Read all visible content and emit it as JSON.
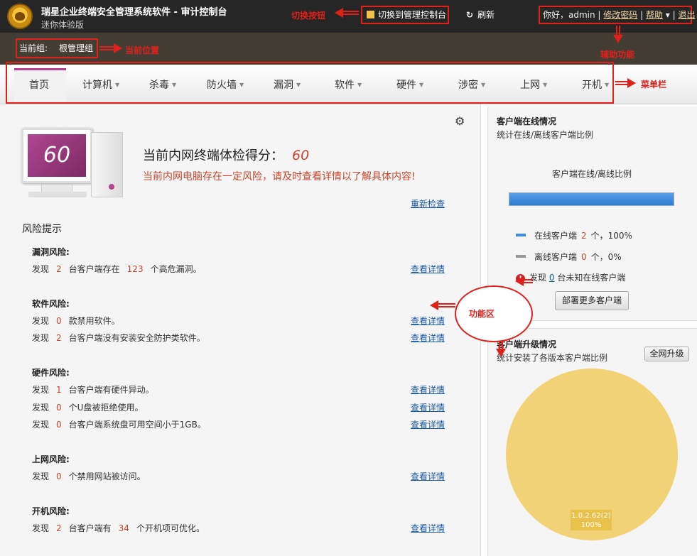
{
  "header": {
    "app_title": "瑞星企业终端安全管理系统软件 - 审计控制台",
    "subtitle": "迷你体验版",
    "switch_button": "切换到管理控制台",
    "refresh": "刷新",
    "greeting": "你好，admin",
    "change_password": "修改密码",
    "help": "帮助",
    "logout": "退出"
  },
  "annotations": {
    "switch": "切换按钮",
    "location": "当前位置",
    "aux": "辅助功能",
    "menu": "菜单栏",
    "function": "功能区"
  },
  "group": {
    "label": "当前组:",
    "value": "根管理组"
  },
  "menu": [
    "首页",
    "计算机",
    "杀毒",
    "防火墙",
    "漏洞",
    "软件",
    "硬件",
    "涉密",
    "上网",
    "开机"
  ],
  "score": {
    "title": "当前内网终端体检得分：",
    "value": "60",
    "warning": "当前内网电脑存在一定风险，请及时查看详情以了解具体内容!",
    "recheck": "重新检查"
  },
  "risks": {
    "heading": "风险提示",
    "detail_link": "查看详情",
    "categories": [
      {
        "name": "漏洞风险:",
        "rows": [
          {
            "pre": "发现",
            "n": "2",
            "mid": "台客户端存在",
            "n2": "123",
            "post": "个高危漏洞。"
          }
        ]
      },
      {
        "name": "软件风险:",
        "rows": [
          {
            "pre": "发现",
            "n": "0",
            "mid": "款禁用软件。"
          },
          {
            "pre": "发现",
            "n": "2",
            "mid": "台客户端没有安装安全防护类软件。"
          }
        ]
      },
      {
        "name": "硬件风险:",
        "rows": [
          {
            "pre": "发现",
            "n": "1",
            "mid": "台客户端有硬件异动。"
          },
          {
            "pre": "发现",
            "n": "0",
            "mid": "个U盘被拒绝使用。"
          },
          {
            "pre": "发现",
            "n": "0",
            "mid": "台客户端系统盘可用空间小于1GB。"
          }
        ]
      },
      {
        "name": "上网风险:",
        "rows": [
          {
            "pre": "发现",
            "n": "0",
            "mid": "个禁用网站被访问。"
          }
        ]
      },
      {
        "name": "开机风险:",
        "rows": [
          {
            "pre": "发现",
            "n": "2",
            "mid": "台客户端有",
            "n2": "34",
            "post": "个开机项可优化。"
          }
        ]
      }
    ]
  },
  "online_panel": {
    "title": "客户端在线情况",
    "subtitle": "统计在线/离线客户端比例",
    "chart_title": "客户端在线/离线比例",
    "online_fraction": 1.0,
    "online_pre": "在线客户端",
    "online_n": "2",
    "online_post": "个，100%",
    "offline_pre": "离线客户端",
    "offline_n": "0",
    "offline_post": "个，0%",
    "unknown_pre": "发现",
    "unknown_n": "0",
    "unknown_post": "台未知在线客户端",
    "deploy_button": "部署更多客户端",
    "online_color": "#3a8ee0",
    "offline_color": "#999999"
  },
  "upgrade_panel": {
    "title": "客户端升级情况",
    "subtitle": "统计安装了各版本客户端比例",
    "upgrade_button": "全网升级",
    "pie_version": "1.0.2.62(2)",
    "pie_percent": "100%",
    "pie_color": "#f2d277"
  }
}
